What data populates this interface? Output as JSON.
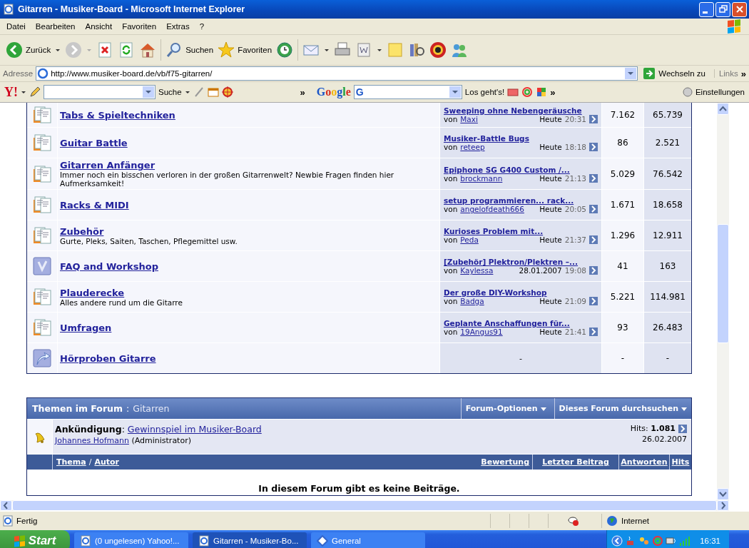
{
  "window": {
    "title": "Gitarren - Musiker-Board - Microsoft Internet Explorer"
  },
  "menu": [
    "Datei",
    "Bearbeiten",
    "Ansicht",
    "Favoriten",
    "Extras",
    "?"
  ],
  "toolbar": {
    "back": "Zurück",
    "search": "Suchen",
    "favorites": "Favoriten"
  },
  "address": {
    "label": "Adresse",
    "url": "http://www.musiker-board.de/vb/f75-gitarren/",
    "go": "Wechseln zu",
    "links": "Links",
    "more": "»"
  },
  "search_toolbar": {
    "logo": "Y!",
    "search_button": "Suche",
    "more": "»",
    "google": "Google",
    "google_g": "G",
    "go_button": "Los geht's!",
    "more2": "»",
    "settings": "Einstellungen"
  },
  "forums": [
    {
      "kind": "forum",
      "title": "Tabs & Spieltechniken",
      "last_post": {
        "title": "Sweeping ohne Nebengeräusche",
        "by": "von",
        "author": "Maxi",
        "date": "Heute",
        "time": "20:31"
      },
      "threads": "7.162",
      "posts": "65.739"
    },
    {
      "kind": "forum",
      "title": "Guitar Battle",
      "last_post": {
        "title": "Musiker-Battle Bugs",
        "by": "von",
        "author": "reteep",
        "date": "Heute",
        "time": "18:18"
      },
      "threads": "86",
      "posts": "2.521"
    },
    {
      "kind": "forum",
      "title": "Gitarren Anfänger",
      "description": "Immer noch ein bisschen verloren in der großen Gitarrenwelt? Newbie Fragen finden hier Aufmerksamkeit!",
      "last_post": {
        "title": "Epiphone SG G400 Custom /...",
        "by": "von",
        "author": "brockmann",
        "date": "Heute",
        "time": "21:13"
      },
      "threads": "5.029",
      "posts": "76.542"
    },
    {
      "kind": "forum",
      "title": "Racks & MIDI",
      "last_post": {
        "title": "setup programmieren... rack...",
        "by": "von",
        "author": "angelofdeath666",
        "date": "Heute",
        "time": "20:05"
      },
      "threads": "1.671",
      "posts": "18.658"
    },
    {
      "kind": "forum",
      "title": "Zubehör",
      "description": "Gurte, Pleks, Saiten, Taschen, Pflegemittel usw.",
      "last_post": {
        "title": "Kurioses Problem mit...",
        "by": "von",
        "author": "Peda",
        "date": "Heute",
        "time": "21:37"
      },
      "threads": "1.296",
      "posts": "12.911"
    },
    {
      "kind": "faq",
      "title": "FAQ and Workshop",
      "last_post": {
        "title": "[Zubehör] Plektron/Plektren –...",
        "by": "von",
        "author": "Kaylessa",
        "date": "28.01.2007",
        "time": "19:08"
      },
      "threads": "41",
      "posts": "163"
    },
    {
      "kind": "forum",
      "title": "Plauderecke",
      "description": "Alles andere rund um die Gitarre",
      "last_post": {
        "title": "Der große DIY-Workshop",
        "by": "von",
        "author": "Badga",
        "date": "Heute",
        "time": "21:09"
      },
      "threads": "5.221",
      "posts": "114.981"
    },
    {
      "kind": "forum",
      "title": "Umfragen",
      "last_post": {
        "title": "Geplante Anschaffungen für...",
        "by": "von",
        "author": "19Angus91",
        "date": "Heute",
        "time": "21:41"
      },
      "threads": "93",
      "posts": "26.483"
    },
    {
      "kind": "link",
      "title": "Hörproben Gitarre",
      "last_post": {
        "empty": "-"
      },
      "threads": "-",
      "posts": "-"
    }
  ],
  "threads_section": {
    "title": "Themen im Forum",
    "separator": ":",
    "forum": "Gitarren",
    "options": "Forum-Optionen",
    "search": "Dieses Forum durchsuchen",
    "announcement": {
      "label": "**Ankündigung**:",
      "link": "Gewinnspiel im Musiker-Board",
      "author": "Johannes Hofmann",
      "role": "(Administrator)",
      "hits": "Hits: **1.081**",
      "date": "26.02.2007"
    },
    "first_column": [
      "Thema",
      "/",
      "Autor"
    ],
    "columns": [
      "Bewertung",
      "Letzter Beitrag",
      "Antworten",
      "Hits"
    ],
    "empty_message": "In diesem Forum gibt es keine Beiträge."
  },
  "status": {
    "text": "Fertig",
    "zone": "Internet"
  },
  "taskbar": {
    "start": "Start",
    "tasks": [
      {
        "label": "(0 ungelesen) Yahoo!...",
        "selected": false
      },
      {
        "label": "Gitarren - Musiker-Bo...",
        "selected": true
      },
      {
        "label": "General",
        "selected": false
      }
    ],
    "clock": "16:31"
  }
}
